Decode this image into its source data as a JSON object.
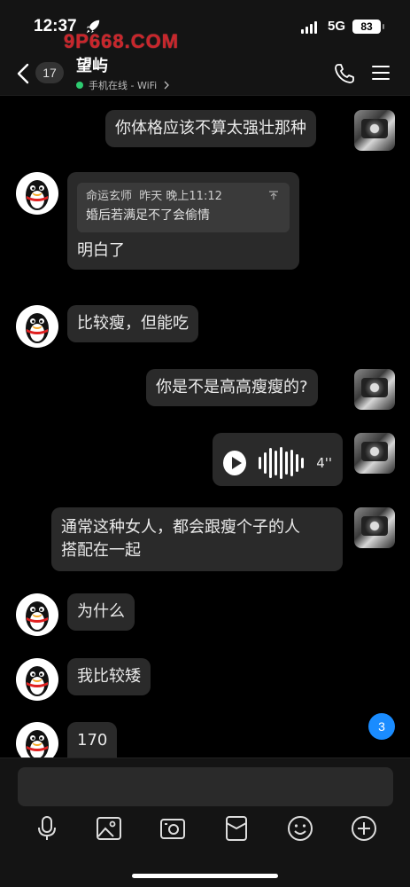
{
  "status_bar": {
    "time": "12:37",
    "network": "5G",
    "battery": "83",
    "watermark": "9P668.COM"
  },
  "header": {
    "unread_count": "17",
    "contact_name": "望屿",
    "online_status": "手机在线 - WiFi"
  },
  "messages": [
    {
      "side": "right",
      "type": "text",
      "text": "你体格应该不算太强壮那种"
    },
    {
      "side": "left",
      "type": "quote_reply",
      "quote": {
        "sender": "命运玄师",
        "time": "昨天 晚上11:12",
        "text": "婚后若满足不了会偷情"
      },
      "text": "明白了"
    },
    {
      "side": "left",
      "type": "text",
      "text": "比较瘦，但能吃"
    },
    {
      "side": "right",
      "type": "text",
      "text": "你是不是高高瘦瘦的?"
    },
    {
      "side": "right",
      "type": "voice",
      "duration": "4''"
    },
    {
      "side": "right",
      "type": "text",
      "lines": [
        "通常这种女人，都会跟瘦个子的人",
        "搭配在一起"
      ]
    },
    {
      "side": "left",
      "type": "text",
      "text": "为什么"
    },
    {
      "side": "left",
      "type": "text",
      "text": "我比较矮"
    },
    {
      "side": "left",
      "type": "text",
      "text": "170"
    }
  ],
  "new_message_badge": "3",
  "input": {
    "placeholder": ""
  },
  "toolbar": [
    "mic-icon",
    "image-icon",
    "camera-icon",
    "red-packet-icon",
    "emoji-icon",
    "plus-icon"
  ],
  "colors": {
    "background": "#000000",
    "bubble": "#2a2a2a",
    "badge": "#1a8cff",
    "online": "#2ecc71",
    "watermark": "#c9252b"
  }
}
